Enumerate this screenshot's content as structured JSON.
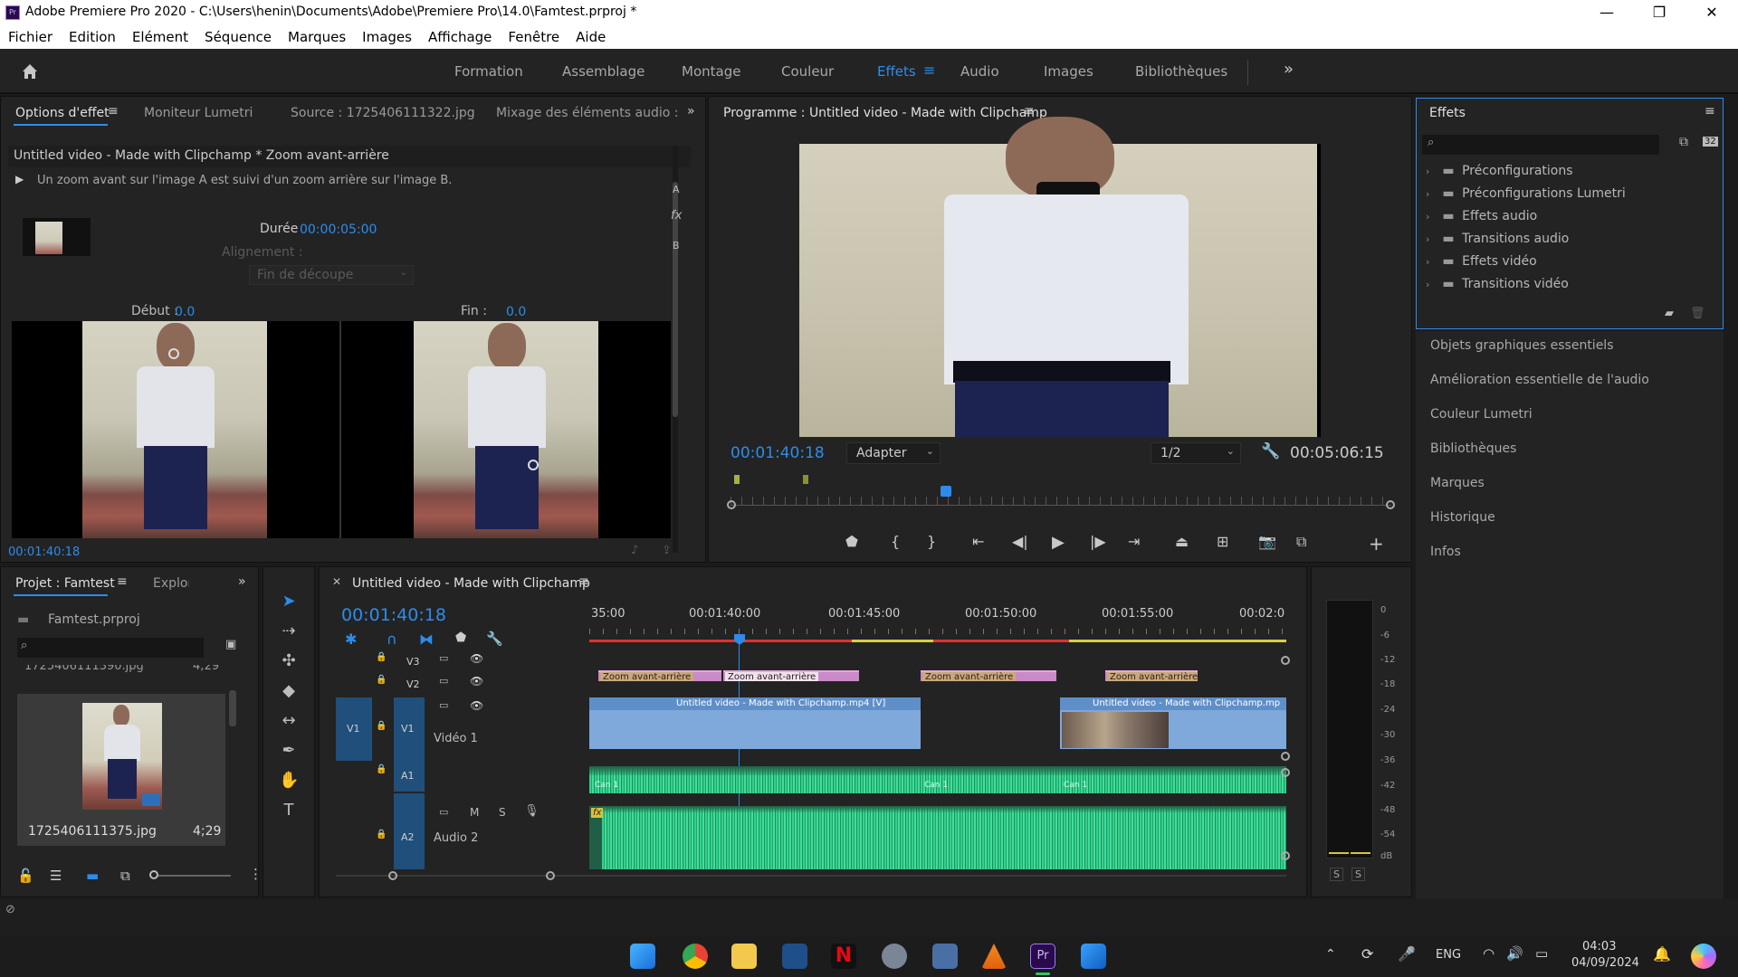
{
  "window": {
    "title": "Adobe Premiere Pro 2020 - C:\\Users\\henin\\Documents\\Adobe\\Premiere Pro\\14.0\\Famtest.prproj *",
    "app_icon_text": "Pr"
  },
  "menu": [
    "Fichier",
    "Edition",
    "Elément",
    "Séquence",
    "Marques",
    "Images",
    "Affichage",
    "Fenêtre",
    "Aide"
  ],
  "workspaces": [
    "Formation",
    "Assemblage",
    "Montage",
    "Couleur",
    "Effets",
    "Audio",
    "Images",
    "Bibliothèques"
  ],
  "workspace_active": "Effets",
  "effect_options": {
    "tabs": [
      "Options d'effet",
      "Moniteur Lumetri",
      "Source : 1725406111322.jpg",
      "Mixage des éléments audio :"
    ],
    "clip_title": "Untitled video - Made with Clipchamp * Zoom avant-arrière",
    "description": "Un zoom avant sur l'image A est suivi d'un zoom arrière sur l'image B.",
    "duration_label": "Durée",
    "duration_value": "00:00:05:00",
    "alignment_label": "Alignement :",
    "alignment_value": "Fin de découpe",
    "start_label": "Début :",
    "start_value": "0.0",
    "end_label": "Fin :",
    "end_value": "0.0",
    "side_letters": [
      "A",
      "fx",
      "B"
    ],
    "timecode": "00:01:40:18"
  },
  "program": {
    "title": "Programme : Untitled video - Made with Clipchamp",
    "timecode": "00:01:40:18",
    "fit": "Adapter",
    "resolution": "1/2",
    "duration": "00:05:06:15"
  },
  "effects_panel": {
    "title": "Effets",
    "badge": "32",
    "items": [
      "Préconfigurations",
      "Préconfigurations Lumetri",
      "Effets audio",
      "Transitions audio",
      "Effets vidéo",
      "Transitions vidéo"
    ],
    "side_panels": [
      "Objets graphiques essentiels",
      "Amélioration essentielle de l'audio",
      "Couleur Lumetri",
      "Bibliothèques",
      "Marques",
      "Historique",
      "Infos"
    ]
  },
  "project": {
    "tabs": [
      "Projet : Famtest",
      "Explorateur"
    ],
    "file": "Famtest.prproj",
    "items": [
      {
        "name": "1725406111390.jpg",
        "duration": "4;29"
      },
      {
        "name": "1725406111375.jpg",
        "duration": "4;29"
      }
    ]
  },
  "timeline": {
    "title": "Untitled video - Made with Clipchamp",
    "timecode": "00:01:40:18",
    "ruler": [
      "35:00",
      "00:01:40:00",
      "00:01:45:00",
      "00:01:50:00",
      "00:01:55:00",
      "00:02:0"
    ],
    "tracks": {
      "v3": "V3",
      "v2": "V2",
      "v1": "V1",
      "v1_name": "Vidéo 1",
      "a1": "A1",
      "a2": "A2",
      "a2_name": "Audio 2",
      "m": "M",
      "s": "S"
    },
    "v2_clips": [
      "Zoom avant-arrière",
      "Zoom avant-arrière",
      "Zoom avant-arrière",
      "Zoom avant-arrière"
    ],
    "v1_clips": [
      "Untitled video - Made with Clipchamp.mp4 [V]",
      "Untitled video - Made with Clipchamp.mp"
    ],
    "a1_clip_labels": [
      "Can 1",
      "Can 1",
      "Can 1"
    ],
    "fx_badge": "fx"
  },
  "meter": {
    "scale": [
      "0",
      "-6",
      "-12",
      "-18",
      "-24",
      "-30",
      "-36",
      "-42",
      "-48",
      "-54",
      "dB"
    ],
    "solo": [
      "S",
      "S"
    ]
  },
  "taskbar": {
    "lang": "ENG",
    "time": "04:03",
    "date": "04/09/2024"
  }
}
